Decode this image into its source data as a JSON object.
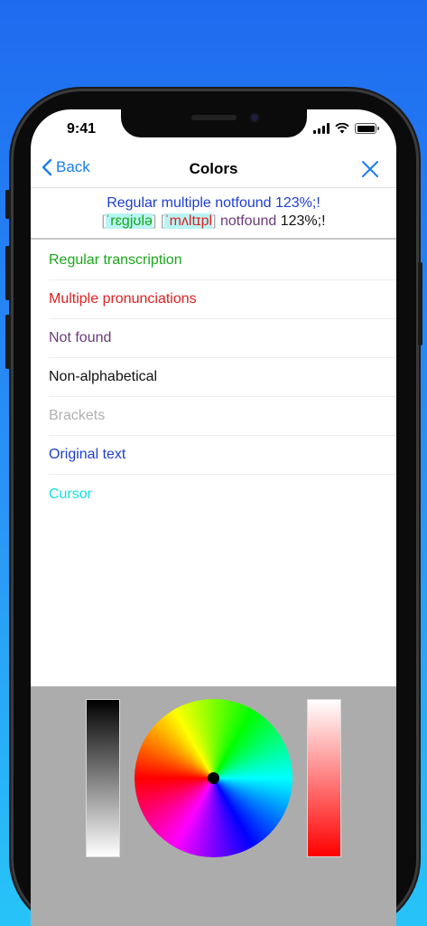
{
  "status": {
    "time": "9:41"
  },
  "nav": {
    "back_label": "Back",
    "title": "Colors"
  },
  "preview": {
    "line1": "Regular  multiple notfound 123%;!",
    "line2": {
      "br_open1": "[",
      "regular": "ˈrɛgjʊlə",
      "br_close1": "]",
      "br_open2": " [",
      "multiple": "ˈmʌltɪpl",
      "br_close2": "]",
      "notfound": " notfound",
      "nonalpha": " 123%;!"
    }
  },
  "list": [
    {
      "label": "Regular transcription",
      "color": "#1aa71a"
    },
    {
      "label": "Multiple pronunciations",
      "color": "#e02020"
    },
    {
      "label": "Not found",
      "color": "#6a3a78"
    },
    {
      "label": "Non-alphabetical",
      "color": "#111111"
    },
    {
      "label": "Brackets",
      "color": "#b0b0b0"
    },
    {
      "label": "Original text",
      "color": "#1e3ecf"
    },
    {
      "label": "Cursor",
      "color": "#14e0e0"
    }
  ],
  "icons": {
    "back": "chevron-left-icon",
    "close": "close-icon",
    "signal": "cellular-signal-icon",
    "wifi": "wifi-icon",
    "battery": "battery-icon"
  },
  "colors": {
    "accent": "#1a7cf4",
    "picker_background": "#acacac"
  }
}
